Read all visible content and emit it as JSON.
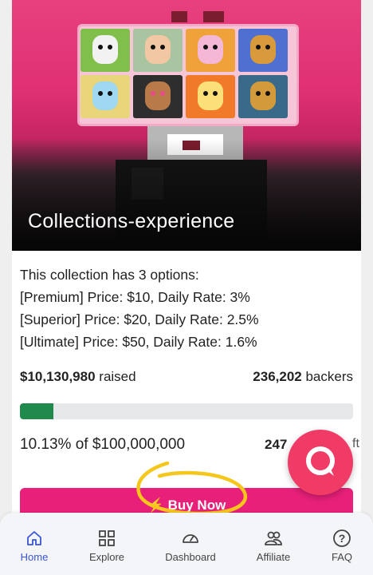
{
  "collection": {
    "title": "Collections-experience",
    "description_lines": [
      "This collection has 3 options:",
      "[Premium] Price: $10, Daily Rate: 3%",
      "[Superior] Price: $20, Daily Rate: 2.5%",
      "[Ultimate] Price: $50, Daily Rate: 1.6%"
    ]
  },
  "stats": {
    "raised_amount": "$10,130,980",
    "raised_label": "raised",
    "backers_count": "236,202",
    "backers_label": "backers",
    "progress_fraction": 0.1013,
    "progress_text": "10.13% of $100,000,000",
    "days_value": "247",
    "days_suffix": "ft"
  },
  "buy_button": {
    "label": "Buy Now",
    "icon": "lightning-icon"
  },
  "chat_button": {
    "icon": "chat-bubble-icon"
  },
  "colors": {
    "accent_pink": "#e8207a",
    "progress_green": "#1f8a4c",
    "nav_active": "#3a55d6",
    "annotation_yellow": "#f5c61b"
  },
  "nav": {
    "items": [
      {
        "label": "Home",
        "icon": "home-icon",
        "active": true
      },
      {
        "label": "Explore",
        "icon": "grid-icon",
        "active": false
      },
      {
        "label": "Dashboard",
        "icon": "gauge-icon",
        "active": false
      },
      {
        "label": "Affiliate",
        "icon": "users-icon",
        "active": false
      },
      {
        "label": "FAQ",
        "icon": "question-icon",
        "active": false
      }
    ]
  }
}
